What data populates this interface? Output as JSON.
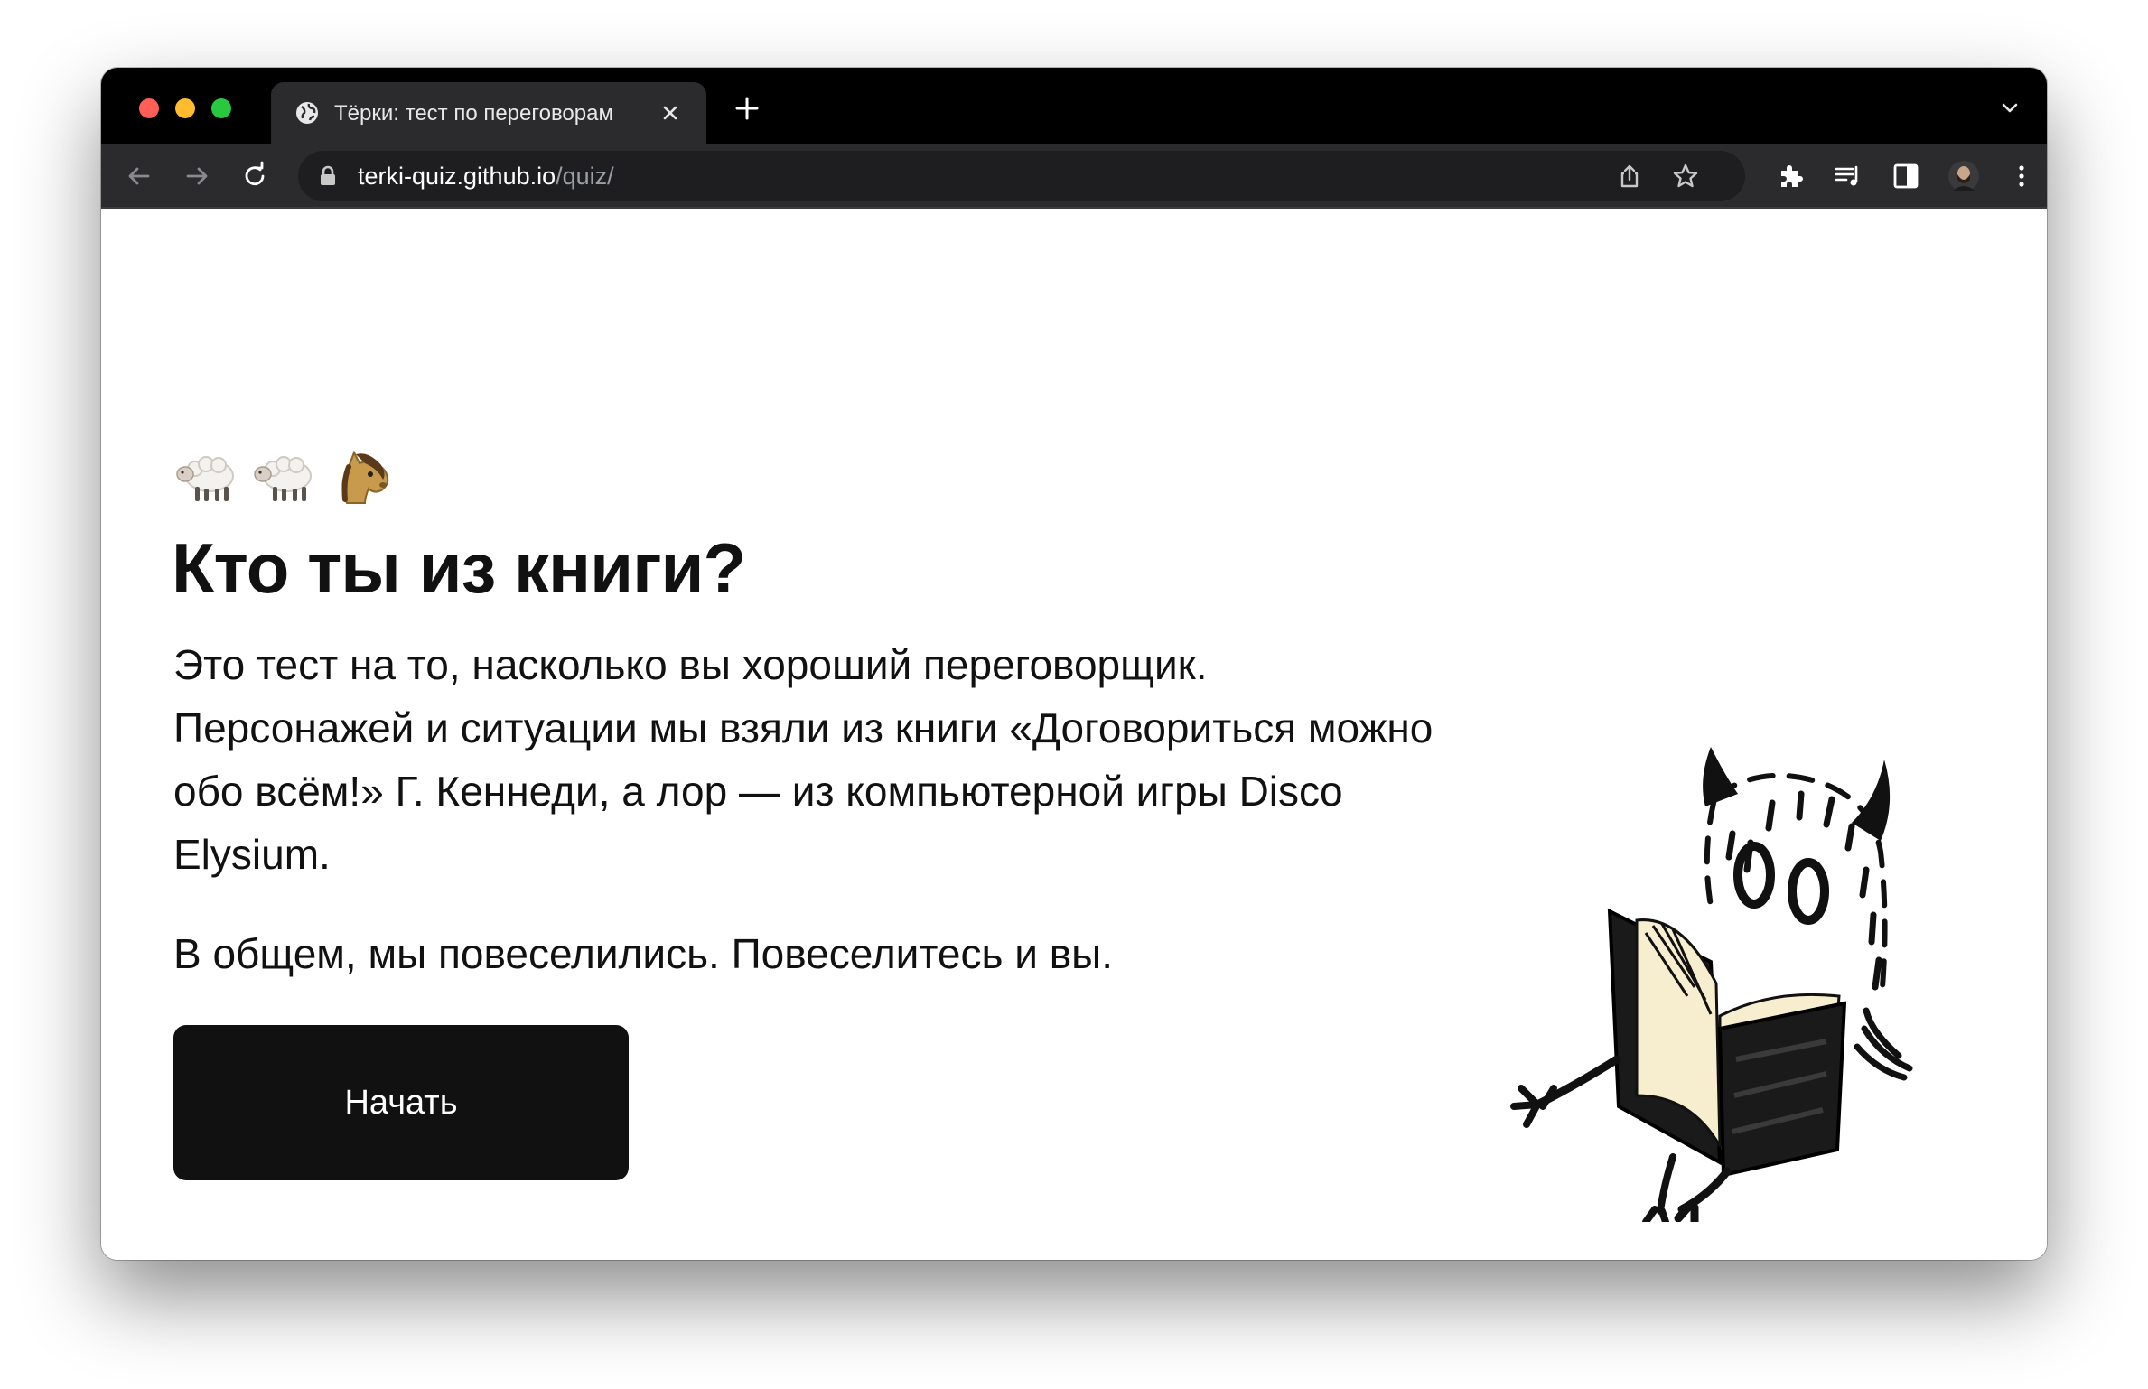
{
  "browser": {
    "tab_title": "Тёрки: тест по переговорам",
    "url_host": "terki-quiz.github.io",
    "url_path": "/quiz/"
  },
  "page": {
    "emojis": [
      "sheep",
      "sheep",
      "horse"
    ],
    "title": "Кто ты из книги?",
    "intro": "Это тест на то, насколько вы хороший переговорщик. Персонажей и ситуации мы взяли из книги «Договориться можно обо всём!» Г. Кеннеди, а лор — из компьютерной игры Disco Elysium.",
    "outro": "В общем, мы повеселились. Повеселитесь и вы.",
    "start_button": "Начать"
  },
  "colors": {
    "accent": "#111111",
    "tabstrip": "#000000",
    "toolbar": "#2b2b2d"
  }
}
